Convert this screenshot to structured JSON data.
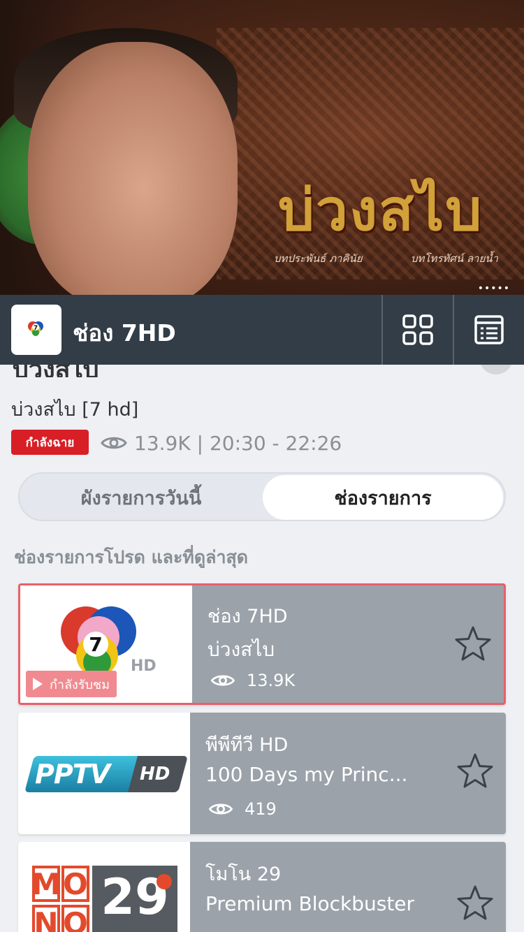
{
  "player": {
    "title_art": "บ่วงสไบ",
    "credit_left": "บทประพันธ์ ภาคินัย",
    "credit_right": "บทโทรทัศน์ ลายน้ำ",
    "more_dots": "•••••"
  },
  "header": {
    "channel_title": "ช่อง 7HD",
    "logo_text": "7"
  },
  "program": {
    "title_partial": "บ่วงสไบ",
    "subtitle": "บ่วงสไบ [7 hd]",
    "live_badge": "กำลังฉาย",
    "meta": "13.9K | 20:30 - 22:26"
  },
  "tabs": [
    {
      "label": "ผังรายการวันนี้",
      "active": false
    },
    {
      "label": "ช่องรายการ",
      "active": true
    }
  ],
  "section_title": "ช่องรายการโปรด และที่ดูล่าสุด",
  "channels": [
    {
      "name": "ช่อง 7HD",
      "program": "บ่วงสไบ",
      "views": "13.9K",
      "watching_label": "กำลังรับชม",
      "logo": "7",
      "logo_hd": "HD"
    },
    {
      "name": "พีพีทีวี HD",
      "program": "100 Days my Princ...",
      "views": "419",
      "logo": "PPTV",
      "logo_hd": "HD"
    },
    {
      "name": "โมโน 29",
      "program": "Premium Blockbuster",
      "logo_row1": [
        "M",
        "O"
      ],
      "logo_row2": [
        "N",
        "O"
      ],
      "logo_num": "29"
    }
  ],
  "colors": {
    "header_bg": "#333d47",
    "live_red": "#d81f26",
    "card_bg": "#9ba2aa",
    "active_border": "#e8606a"
  }
}
